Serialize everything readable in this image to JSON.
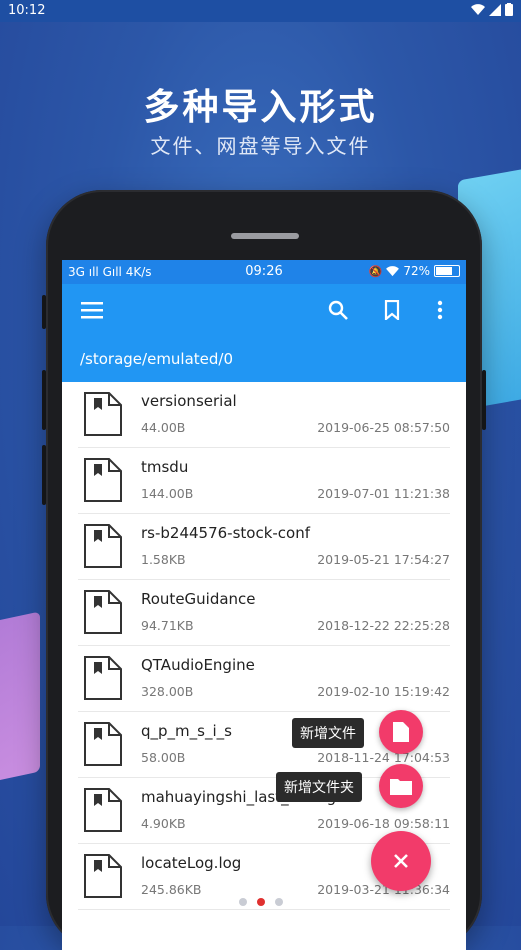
{
  "outer_status": {
    "time": "10:12"
  },
  "promo": {
    "title": "多种导入形式",
    "subtitle": "文件、网盘等导入文件"
  },
  "inner_status": {
    "network": "3G",
    "speed": "4K/s",
    "time": "09:26",
    "battery": "72%"
  },
  "toolbar": {
    "menu_icon": "hamburger-icon",
    "search_icon": "search-icon",
    "bookmark_icon": "bookmark-icon",
    "more_icon": "more-vert-icon"
  },
  "path": "/storage/emulated/0",
  "files": [
    {
      "name": "versionserial",
      "size": "44.00B",
      "date": "2019-06-25 08:57:50"
    },
    {
      "name": "tmsdu",
      "size": "144.00B",
      "date": "2019-07-01 11:21:38"
    },
    {
      "name": "rs-b244576-stock-conf",
      "size": "1.58KB",
      "date": "2019-05-21 17:54:27"
    },
    {
      "name": "RouteGuidance",
      "size": "94.71KB",
      "date": "2018-12-22 22:25:28"
    },
    {
      "name": "QTAudioEngine",
      "size": "328.00B",
      "date": "2019-02-10 15:19:42"
    },
    {
      "name": "q_p_m_s_i_s",
      "size": "58.00B",
      "date": "2018-11-24 17:04:53"
    },
    {
      "name": "mahuayingshi_last_err.log",
      "size": "4.90KB",
      "date": "2019-06-18 09:58:11"
    },
    {
      "name": "locateLog.log",
      "size": "245.86KB",
      "date": "2019-03-21 11:36:34"
    }
  ],
  "fab": {
    "new_file_label": "新增文件",
    "new_folder_label": "新增文件夹",
    "main_icon": "close-icon"
  },
  "pager": {
    "count": 3,
    "active": 2
  },
  "colors": {
    "primary": "#2196f3",
    "accent": "#f23b6a"
  }
}
